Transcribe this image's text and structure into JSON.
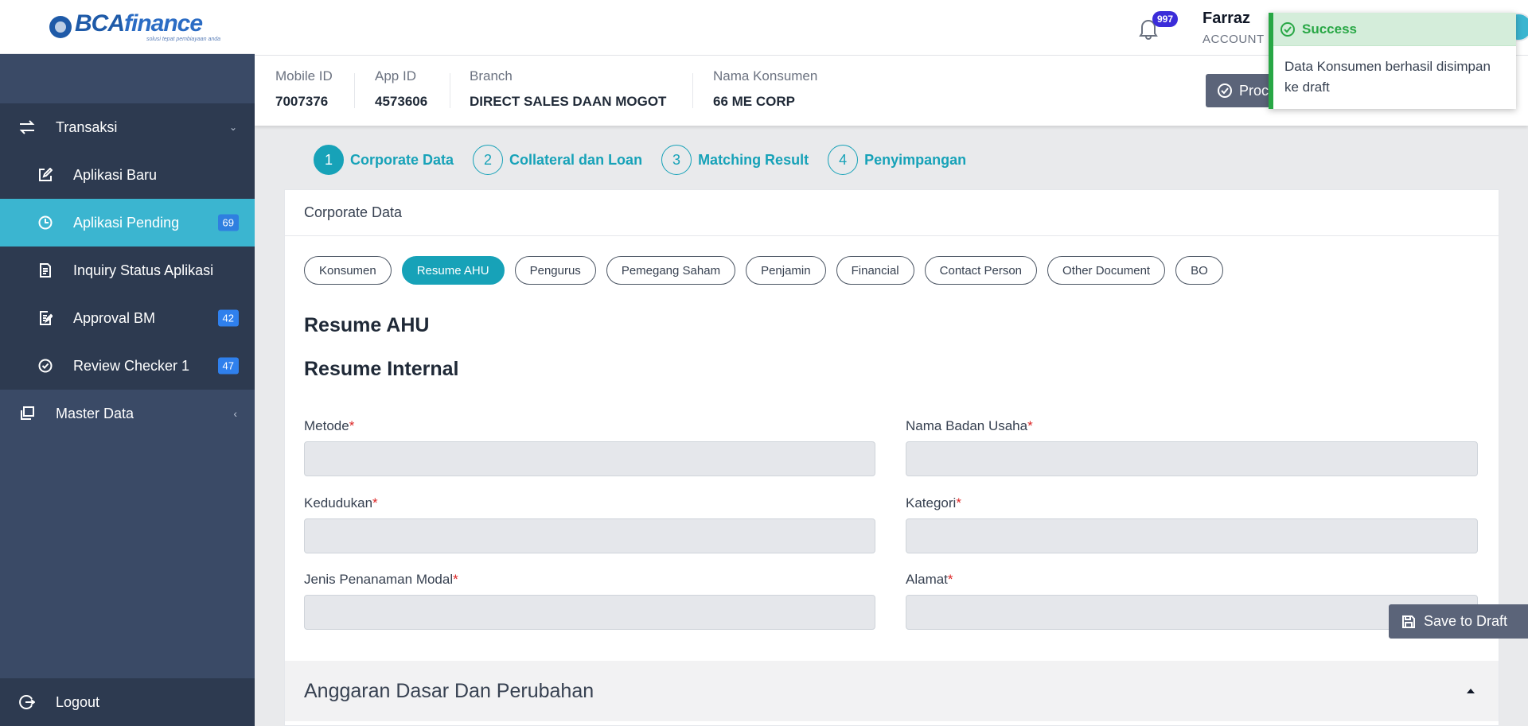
{
  "brand": {
    "logo_word": "BCA",
    "logo_word2": "finance",
    "tagline": "solusi tepat pembiayaan anda"
  },
  "sidebar": {
    "transaksi": {
      "label": "Transaksi"
    },
    "items": [
      {
        "label": "Aplikasi Baru",
        "badge": ""
      },
      {
        "label": "Aplikasi Pending",
        "badge": "69"
      },
      {
        "label": "Inquiry Status Aplikasi",
        "badge": ""
      },
      {
        "label": "Approval BM",
        "badge": "42"
      },
      {
        "label": "Review Checker 1",
        "badge": "47"
      }
    ],
    "master": {
      "label": "Master Data"
    },
    "logout": {
      "label": "Logout"
    }
  },
  "topbar": {
    "notification_count": "997",
    "user_name": "Farraz",
    "user_role": "ACCOUNT R"
  },
  "info": {
    "mobile_id": {
      "label": "Mobile ID",
      "value": "7007376"
    },
    "app_id": {
      "label": "App ID",
      "value": "4573606"
    },
    "branch": {
      "label": "Branch",
      "value": "DIRECT SALES DAAN MOGOT"
    },
    "nama_konsumen": {
      "label": "Nama Konsumen",
      "value": "66 ME CORP"
    },
    "process_label": "Proce"
  },
  "steps": [
    {
      "num": "1",
      "label": "Corporate Data"
    },
    {
      "num": "2",
      "label": "Collateral dan Loan"
    },
    {
      "num": "3",
      "label": "Matching Result"
    },
    {
      "num": "4",
      "label": "Penyimpangan"
    }
  ],
  "card": {
    "header": "Corporate Data",
    "tabs": [
      "Konsumen",
      "Resume AHU",
      "Pengurus",
      "Pemegang Saham",
      "Penjamin",
      "Financial",
      "Contact Person",
      "Other Document",
      "BO"
    ],
    "active_tab": "Resume AHU",
    "section1": "Resume AHU",
    "section2": "Resume Internal",
    "fields": {
      "metode": {
        "label": "Metode",
        "value": ""
      },
      "nama_badan_usaha": {
        "label": "Nama Badan Usaha",
        "value": ""
      },
      "kedudukan": {
        "label": "Kedudukan",
        "value": ""
      },
      "kategori": {
        "label": "Kategori",
        "value": ""
      },
      "jenis_penanaman_modal": {
        "label": "Jenis Penanaman Modal",
        "value": ""
      },
      "alamat": {
        "label": "Alamat",
        "value": ""
      }
    },
    "required_mark": "*",
    "accordion_title": "Anggaran Dasar Dan Perubahan"
  },
  "save_draft_label": "Save to Draft",
  "toast": {
    "title": "Success",
    "message": "Data Konsumen berhasil disimpan ke draft"
  },
  "colors": {
    "accent": "#17a2b8",
    "sidebar": "#3a4a66",
    "success": "#28a745"
  }
}
